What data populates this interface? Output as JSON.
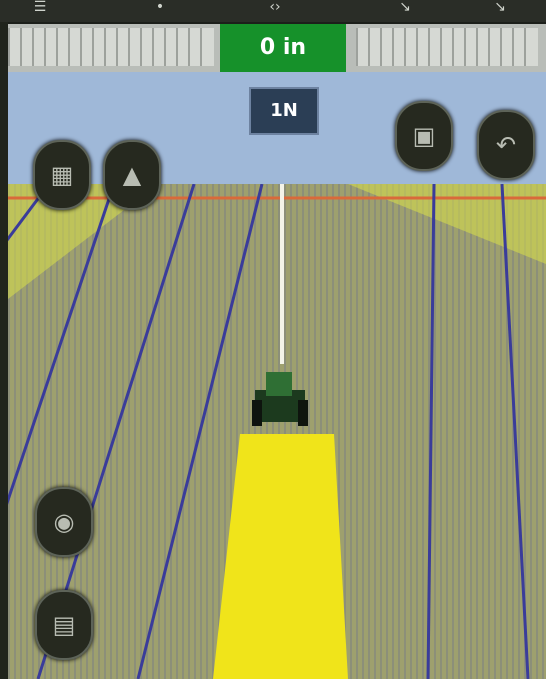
{
  "status_bar": {
    "icons": [
      "menu-icon",
      "signal-icon",
      "gps-icon",
      "zoom-out-icon",
      "zoom-in-icon"
    ]
  },
  "lightbar": {
    "offset_text": "0 in"
  },
  "guidance": {
    "swath_number": "1N"
  },
  "buttons": {
    "top_left_1": "layers-icon",
    "top_left_2": "tractor-view-icon",
    "top_right_1": "camera-view-icon",
    "top_right_2": "turn-icon",
    "bottom_left_1": "recenter-icon",
    "bottom_left_2": "settings-panel-icon"
  },
  "colors": {
    "on_line": "#16912a",
    "coverage": "#f0e41a",
    "sky": "#9fb8d8",
    "guidance_line": "#3a3c9a"
  }
}
